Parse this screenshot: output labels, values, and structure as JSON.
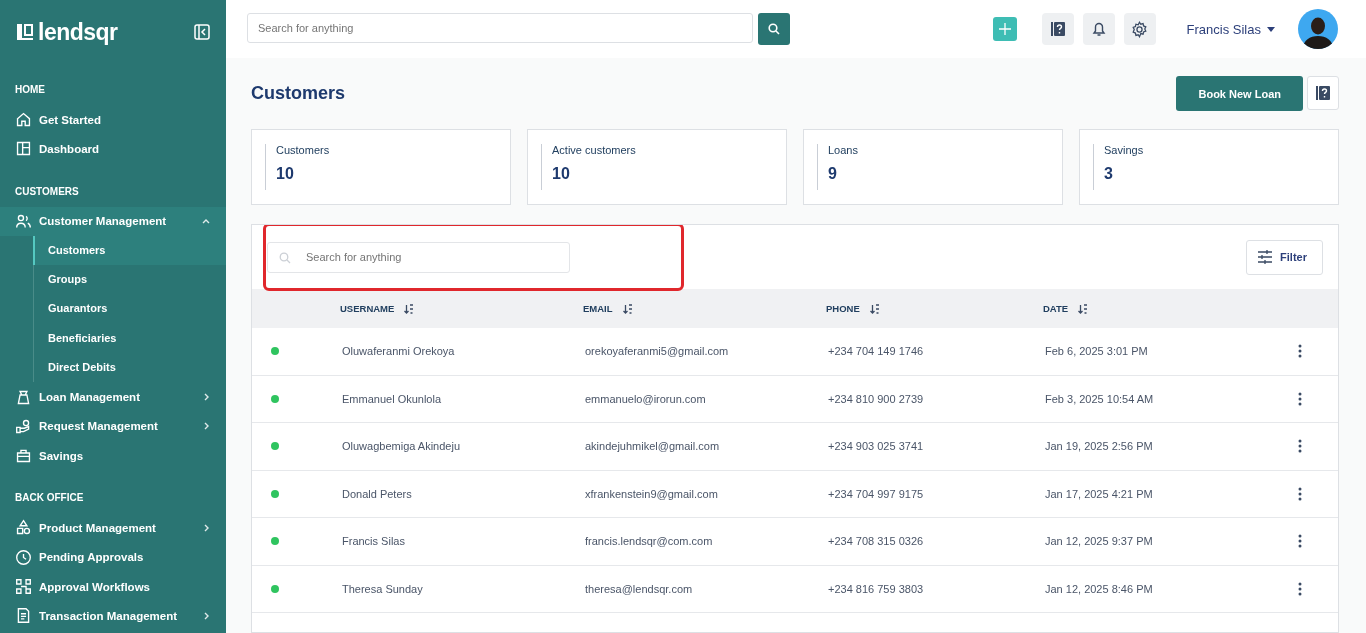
{
  "brand": "lendsqr",
  "sidebar": {
    "sections": [
      {
        "title": "HOME",
        "items": [
          {
            "label": "Get Started",
            "selected": false
          },
          {
            "label": "Dashboard",
            "selected": false
          }
        ]
      },
      {
        "title": "CUSTOMERS",
        "items": [
          {
            "label": "Customer Management",
            "selected": false,
            "expanded": true,
            "children": [
              {
                "label": "Customers",
                "selected": true
              },
              {
                "label": "Groups",
                "selected": false
              },
              {
                "label": "Guarantors",
                "selected": false
              },
              {
                "label": "Beneficiaries",
                "selected": false
              },
              {
                "label": "Direct Debits",
                "selected": false
              }
            ]
          },
          {
            "label": "Loan Management",
            "selected": false,
            "expanded": false
          },
          {
            "label": "Request Management",
            "selected": false,
            "expanded": false
          },
          {
            "label": "Savings",
            "selected": false
          }
        ]
      },
      {
        "title": "BACK OFFICE",
        "items": [
          {
            "label": "Product Management",
            "selected": false,
            "expanded": false
          },
          {
            "label": "Pending Approvals",
            "selected": false
          },
          {
            "label": "Approval Workflows",
            "selected": false
          },
          {
            "label": "Transaction Management",
            "selected": false,
            "expanded": false
          }
        ]
      }
    ]
  },
  "header": {
    "search": {
      "placeholder": "Search for anything"
    },
    "user_name": "Francis Silas"
  },
  "page": {
    "title": "Customers",
    "primary_button": "Book New Loan"
  },
  "stats": [
    {
      "label": "Customers",
      "value": "10"
    },
    {
      "label": "Active customers",
      "value": "10"
    },
    {
      "label": "Loans",
      "value": "9"
    },
    {
      "label": "Savings",
      "value": "3"
    }
  ],
  "table": {
    "search": {
      "placeholder": "Search for anything",
      "highlighted": true
    },
    "filter_button": "Filter",
    "columns": [
      "USERNAME",
      "EMAIL",
      "PHONE",
      "DATE"
    ],
    "rows": [
      {
        "active": true,
        "username": "Oluwaferanmi Orekoya",
        "email": "orekoyaferanmi5@gmail.com",
        "phone": "+234 704 149 1746",
        "date": "Feb 6, 2025 3:01 PM"
      },
      {
        "active": true,
        "username": "Emmanuel Okunlola",
        "email": "emmanuelo@irorun.com",
        "phone": "+234 810 900 2739",
        "date": "Feb 3, 2025 10:54 AM"
      },
      {
        "active": true,
        "username": "Oluwagbemiga Akindeju",
        "email": "akindejuhmikel@gmail.com",
        "phone": "+234 903 025 3741",
        "date": "Jan 19, 2025 2:56 PM"
      },
      {
        "active": true,
        "username": "Donald Peters",
        "email": "xfrankenstein9@gmail.com",
        "phone": "+234 704 997 9175",
        "date": "Jan 17, 2025 4:21 PM"
      },
      {
        "active": true,
        "username": "Francis Silas",
        "email": "francis.lendsqr@com.com",
        "phone": "+234 708 315 0326",
        "date": "Jan 12, 2025 9:37 PM"
      },
      {
        "active": true,
        "username": "Theresa Sunday",
        "email": "theresa@lendsqr.com",
        "phone": "+234 816 759 3803",
        "date": "Jan 12, 2025 8:46 PM"
      }
    ]
  }
}
